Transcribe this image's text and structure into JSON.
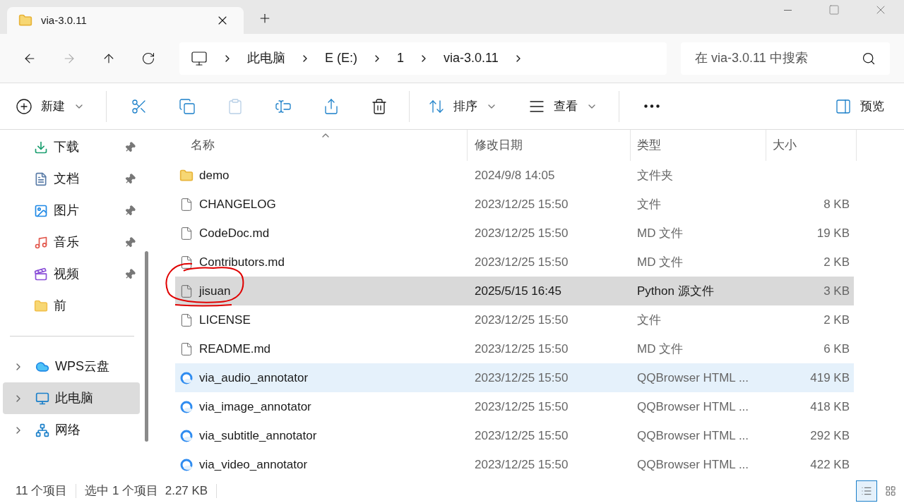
{
  "tab": {
    "title": "via-3.0.11"
  },
  "address": {
    "crumbs": [
      "此电脑",
      "E (E:)",
      "1",
      "via-3.0.11"
    ]
  },
  "search": {
    "placeholder": "在 via-3.0.11 中搜索"
  },
  "toolbar": {
    "new": "新建",
    "sort": "排序",
    "view": "查看",
    "preview": "预览"
  },
  "sidebar": {
    "quick": [
      {
        "label": "下载",
        "kind": "download",
        "pinned": true
      },
      {
        "label": "文档",
        "kind": "document",
        "pinned": true
      },
      {
        "label": "图片",
        "kind": "picture",
        "pinned": true
      },
      {
        "label": "音乐",
        "kind": "music",
        "pinned": true
      },
      {
        "label": "视频",
        "kind": "video",
        "pinned": true
      },
      {
        "label": "前",
        "kind": "folder",
        "pinned": false
      }
    ],
    "locations": [
      {
        "label": "WPS云盘",
        "kind": "cloud",
        "selected": false
      },
      {
        "label": "此电脑",
        "kind": "computer",
        "selected": true
      },
      {
        "label": "网络",
        "kind": "network",
        "selected": false
      }
    ]
  },
  "table": {
    "columns": [
      "名称",
      "修改日期",
      "类型",
      "大小"
    ],
    "rows": [
      {
        "name": "demo",
        "kind": "folder",
        "date": "2024/9/8 14:05",
        "type": "文件夹",
        "selected": false,
        "hovered": false
      },
      {
        "name": "CHANGELOG",
        "kind": "file",
        "date": "2023/12/25 15:50",
        "type": "文件",
        "size": "8 KB",
        "selected": false,
        "hovered": false
      },
      {
        "name": "CodeDoc.md",
        "kind": "file",
        "date": "2023/12/25 15:50",
        "type": "MD 文件",
        "size": "19 KB",
        "selected": false,
        "hovered": false
      },
      {
        "name": "Contributors.md",
        "kind": "file",
        "date": "2023/12/25 15:50",
        "type": "MD 文件",
        "size": "2 KB",
        "selected": false,
        "hovered": false
      },
      {
        "name": "jisuan",
        "kind": "file",
        "date": "2025/5/15 16:45",
        "type": "Python 源文件",
        "size": "3 KB",
        "selected": true,
        "hovered": false
      },
      {
        "name": "LICENSE",
        "kind": "file",
        "date": "2023/12/25 15:50",
        "type": "文件",
        "size": "2 KB",
        "selected": false,
        "hovered": false
      },
      {
        "name": "README.md",
        "kind": "file",
        "date": "2023/12/25 15:50",
        "type": "MD 文件",
        "size": "6 KB",
        "selected": false,
        "hovered": false
      },
      {
        "name": "via_audio_annotator",
        "kind": "html",
        "date": "2023/12/25 15:50",
        "type": "QQBrowser HTML ...",
        "size": "419 KB",
        "selected": false,
        "hovered": true
      },
      {
        "name": "via_image_annotator",
        "kind": "html",
        "date": "2023/12/25 15:50",
        "type": "QQBrowser HTML ...",
        "size": "418 KB",
        "selected": false,
        "hovered": false
      },
      {
        "name": "via_subtitle_annotator",
        "kind": "html",
        "date": "2023/12/25 15:50",
        "type": "QQBrowser HTML ...",
        "size": "292 KB",
        "selected": false,
        "hovered": false
      },
      {
        "name": "via_video_annotator",
        "kind": "html",
        "date": "2023/12/25 15:50",
        "type": "QQBrowser HTML ...",
        "size": "422 KB",
        "selected": false,
        "hovered": false
      }
    ]
  },
  "status_bar": {
    "count": "11 个项目",
    "selection": "选中 1 个项目  2.27 KB"
  }
}
